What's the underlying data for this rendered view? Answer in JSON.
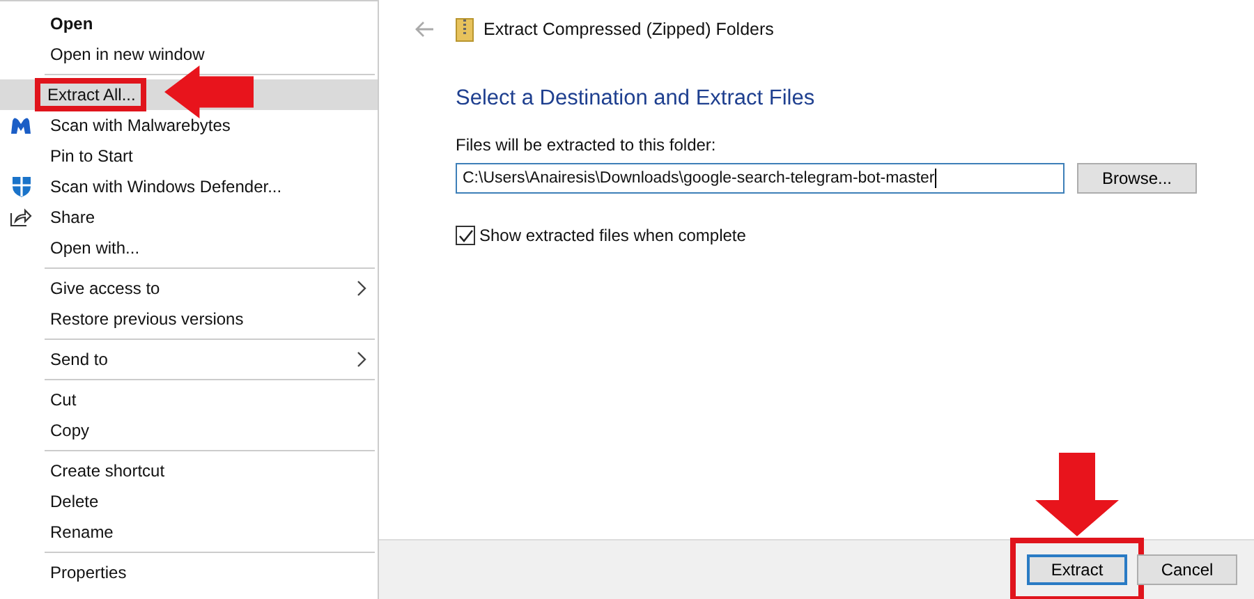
{
  "context_menu": {
    "groups": [
      [
        {
          "label": "Open",
          "default": true,
          "selected": false,
          "submenu": false,
          "marked": false
        },
        {
          "label": "Open in new window",
          "default": false,
          "selected": false,
          "submenu": false,
          "marked": false
        }
      ],
      [
        {
          "label": "Extract All...",
          "default": false,
          "selected": true,
          "submenu": false,
          "marked": true
        },
        {
          "label": "Scan with Malwarebytes",
          "kind": "malware",
          "default": false,
          "selected": false,
          "submenu": false,
          "marked": false
        },
        {
          "label": "Pin to Start",
          "default": false,
          "selected": false,
          "submenu": false,
          "marked": false
        },
        {
          "label": "Scan with Windows Defender...",
          "kind": "shield",
          "default": false,
          "selected": false,
          "submenu": false,
          "marked": false
        },
        {
          "label": "Share",
          "kind": "share",
          "default": false,
          "selected": false,
          "submenu": false,
          "marked": false
        },
        {
          "label": "Open with...",
          "default": false,
          "selected": false,
          "submenu": false,
          "marked": false
        }
      ],
      [
        {
          "label": "Give access to",
          "default": false,
          "selected": false,
          "submenu": true,
          "marked": false
        },
        {
          "label": "Restore previous versions",
          "default": false,
          "selected": false,
          "submenu": false,
          "marked": false
        }
      ],
      [
        {
          "label": "Send to",
          "default": false,
          "selected": false,
          "submenu": true,
          "marked": false
        }
      ],
      [
        {
          "label": "Cut",
          "default": false,
          "selected": false,
          "submenu": false,
          "marked": false
        },
        {
          "label": "Copy",
          "default": false,
          "selected": false,
          "submenu": false,
          "marked": false
        }
      ],
      [
        {
          "label": "Create shortcut",
          "default": false,
          "selected": false,
          "submenu": false,
          "marked": false
        },
        {
          "label": "Delete",
          "default": false,
          "selected": false,
          "submenu": false,
          "marked": false
        },
        {
          "label": "Rename",
          "default": false,
          "selected": false,
          "submenu": false,
          "marked": false
        }
      ],
      [
        {
          "label": "Properties",
          "default": false,
          "selected": false,
          "submenu": false,
          "marked": false
        }
      ]
    ]
  },
  "dialog": {
    "title": "Extract Compressed (Zipped) Folders",
    "heading": "Select a Destination and Extract Files",
    "folder_label": "Files will be extracted to this folder:",
    "folder_path": "C:\\Users\\Anairesis\\Downloads\\google-search-telegram-bot-master",
    "browse_button": "Browse...",
    "show_files": {
      "label": "Show extracted files when complete",
      "checked": true
    },
    "buttons": [
      {
        "label": "Extract",
        "default": true,
        "marked": true
      },
      {
        "label": "Cancel",
        "default": false,
        "marked": false
      }
    ]
  }
}
